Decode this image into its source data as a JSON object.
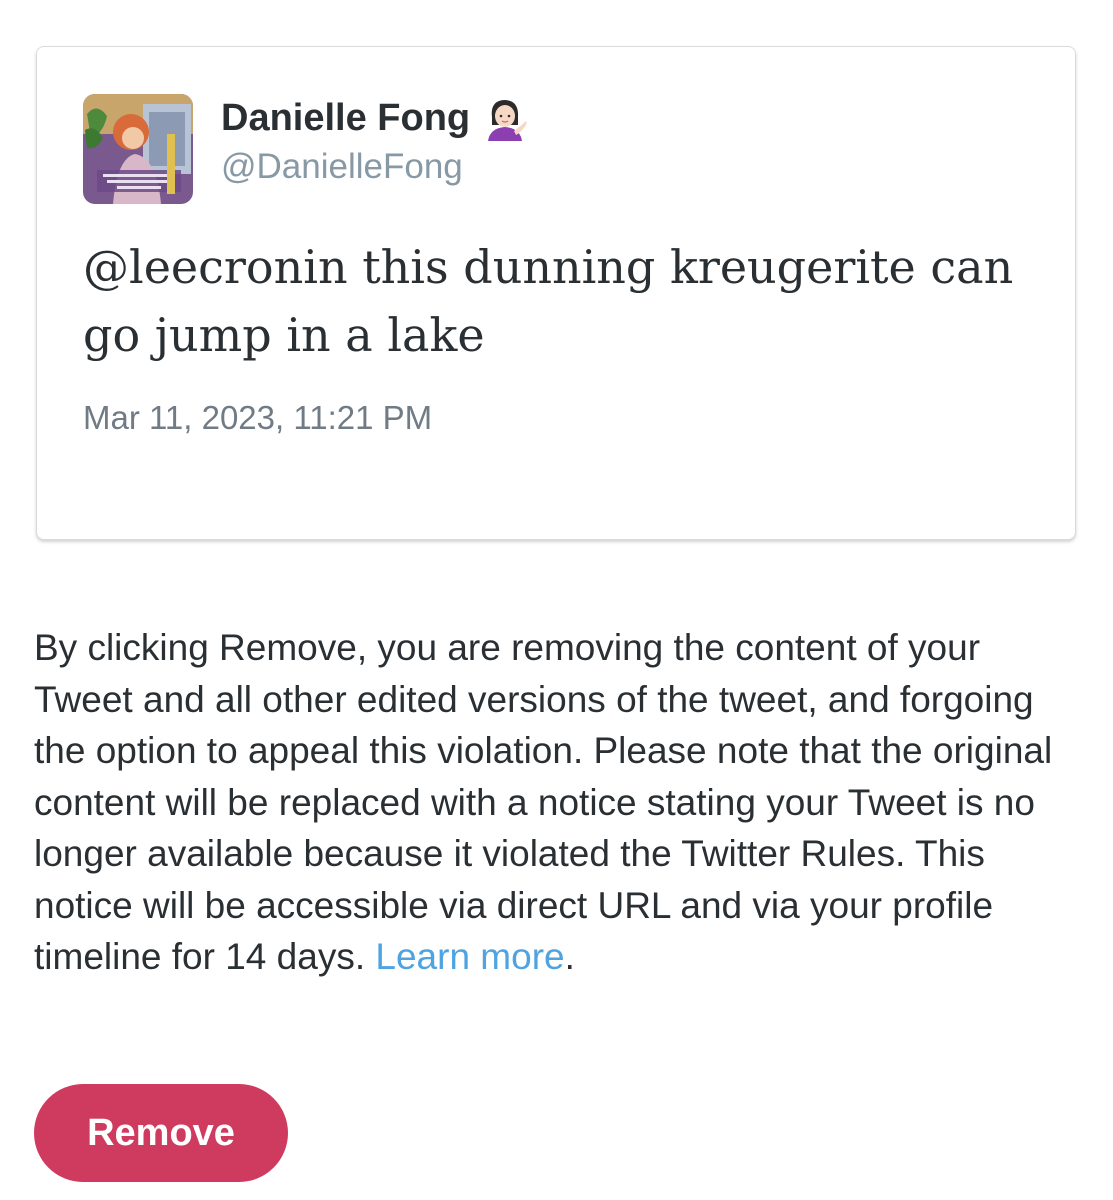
{
  "tweet": {
    "author_name": "Danielle Fong",
    "author_emoji": "person-tipping-hand-emoji",
    "author_handle": "@DanielleFong",
    "text": "@leecronin this dunning kreugerite can go jump in a lake",
    "timestamp": "Mar 11, 2023, 11:21 PM",
    "avatar_icon": "profile-avatar"
  },
  "notice": {
    "body": "By clicking Remove, you are removing the content of your Tweet and all other edited versions of the tweet, and forgoing the option to appeal this violation. Please note that the original content will be replaced with a notice stating your Tweet is no longer available because it violated the Twitter Rules. This notice will be accessible via direct URL and via your profile timeline for 14 days.",
    "link_label": "Learn more",
    "trailing": "."
  },
  "actions": {
    "remove_label": "Remove"
  },
  "colors": {
    "remove_button": "#cf3b5e",
    "link": "#4fa3e0",
    "handle": "#8899a6",
    "text": "#292f33"
  }
}
